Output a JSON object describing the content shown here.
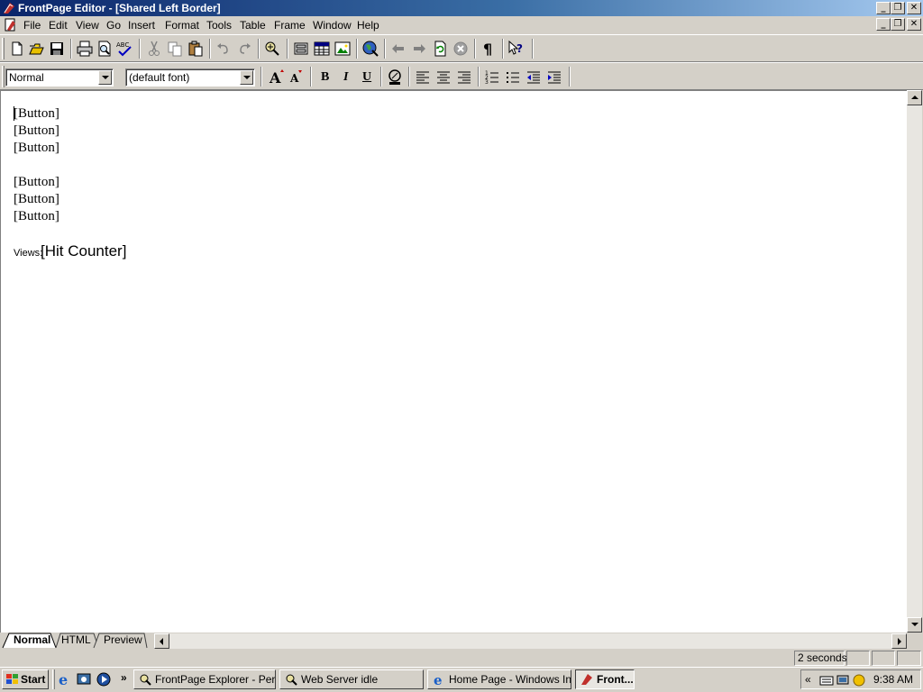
{
  "window": {
    "title": "FrontPage Editor - [Shared Left Border]",
    "controls": {
      "minimize": "_",
      "restore": "❐",
      "close": "✕"
    }
  },
  "menu": [
    "File",
    "Edit",
    "View",
    "Go",
    "Insert",
    "Format",
    "Tools",
    "Table",
    "Frame",
    "Window",
    "Help"
  ],
  "toolbar1": {
    "icons": [
      "new-page-icon",
      "open-icon",
      "save-icon",
      "print-icon",
      "print-preview-icon",
      "spelling-icon",
      "cut-icon",
      "copy-icon",
      "paste-icon",
      "undo-icon",
      "redo-icon",
      "insert-webbot-icon",
      "insert-form-field-icon",
      "insert-table-icon",
      "insert-image-icon",
      "create-hyperlink-icon",
      "back-icon",
      "forward-icon",
      "refresh-icon",
      "stop-icon",
      "show-all-icon",
      "help-icon"
    ]
  },
  "toolbar2": {
    "style_value": "Normal",
    "font_value": "(default font)",
    "icons": [
      "increase-text-size-icon",
      "decrease-text-size-icon",
      "bold-icon",
      "italic-icon",
      "underline-icon",
      "text-color-icon",
      "align-left-icon",
      "center-icon",
      "align-right-icon",
      "numbered-list-icon",
      "bulleted-list-icon",
      "decrease-indent-icon",
      "increase-indent-icon"
    ],
    "bold_glyph": "B",
    "italic_glyph": "I",
    "underline_glyph": "U"
  },
  "document": {
    "buttons_group1": [
      "[Button]",
      "[Button]",
      "[Button]"
    ],
    "buttons_group2": [
      "[Button]",
      "[Button]",
      "[Button]"
    ],
    "views_label": "Views:",
    "hit_counter": "[Hit Counter]"
  },
  "tabs": [
    "Normal",
    "HTML",
    "Preview"
  ],
  "statusbar": {
    "download_time": "2 seconds"
  },
  "taskbar": {
    "start_label": "Start",
    "overflow": "»",
    "tasks": [
      {
        "label": "FrontPage Explorer - Per...",
        "icon": "frontpage-explorer-icon"
      },
      {
        "label": "Web Server idle",
        "icon": "web-server-icon"
      },
      {
        "label": "Home Page - Windows In...",
        "icon": "internet-explorer-icon"
      },
      {
        "label": "Front...",
        "icon": "frontpage-editor-icon"
      }
    ],
    "tray": {
      "chevron": "«",
      "time": "9:38 AM"
    }
  }
}
